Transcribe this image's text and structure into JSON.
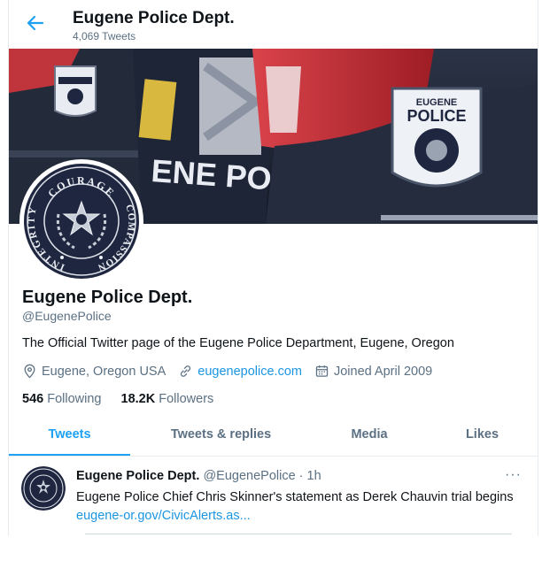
{
  "header": {
    "name": "Eugene Police Dept.",
    "tweet_count": "4,069 Tweets",
    "back_icon": "arrow-left-icon"
  },
  "banner": {
    "vehicle_lettering": "ENE POLICE",
    "badge_top": "EUGENE",
    "badge_main": "POLICE"
  },
  "avatar": {
    "seal_top": "COURAGE",
    "seal_left": "INTEGRITY",
    "seal_right": "COMPASSION"
  },
  "profile": {
    "name": "Eugene Police Dept.",
    "handle": "@EugenePolice",
    "bio": "The Official Twitter page of the Eugene Police Department, Eugene, Oregon",
    "location": "Eugene, Oregon USA",
    "website": "eugenepolice.com",
    "joined": "Joined April 2009",
    "following_count": "546",
    "following_label": "Following",
    "followers_count": "18.2K",
    "followers_label": "Followers"
  },
  "tabs": [
    {
      "label": "Tweets",
      "active": true
    },
    {
      "label": "Tweets & replies",
      "active": false
    },
    {
      "label": "Media",
      "active": false
    },
    {
      "label": "Likes",
      "active": false
    }
  ],
  "tweet": {
    "author": "Eugene Police Dept.",
    "handle_time": "@EugenePolice · 1h",
    "text": "Eugene Police Chief Chris Skinner's statement as Derek Chauvin trial begins",
    "link": "eugene-or.gov/CivicAlerts.as...",
    "more": "···"
  },
  "colors": {
    "accent": "#1da1f2",
    "link": "#1b95e0",
    "muted": "#5b7083",
    "text": "#0f1419"
  }
}
